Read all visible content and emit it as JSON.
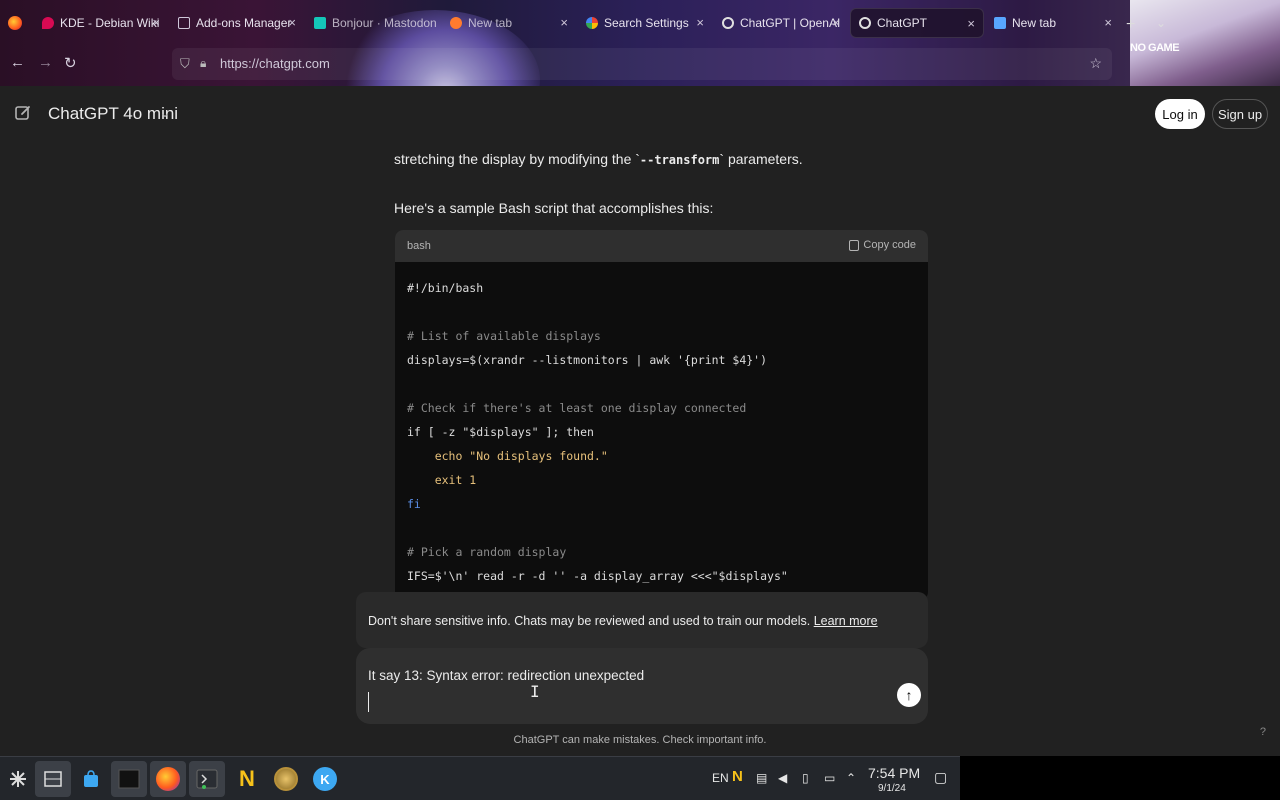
{
  "browser": {
    "tabs": [
      {
        "label": "KDE - Debian Wiki",
        "icon": "debian-icon",
        "color": "#d70a53"
      },
      {
        "label": "Add-ons Manager",
        "icon": "puzzle-icon",
        "color": "#cfc7d9"
      },
      {
        "label": "Bonjour · Mastodon",
        "icon": "mastodon-icon",
        "color": "#14c6b8"
      },
      {
        "label": "New tab",
        "icon": "firefox-icon",
        "color": "#ff7b2e"
      },
      {
        "label": "Search Settings",
        "icon": "google-icon",
        "color": "#4285f4"
      },
      {
        "label": "ChatGPT | OpenAI",
        "icon": "openai-icon",
        "color": "#e0e0e0"
      },
      {
        "label": "ChatGPT",
        "icon": "openai-icon",
        "color": "#e0e0e0"
      },
      {
        "label": "New tab",
        "icon": "firefox-icon",
        "color": "#58a6ff"
      }
    ],
    "close_glyph": "×",
    "url": "https://chatgpt.com",
    "wallpaper_label": "NO GAME"
  },
  "header": {
    "model_name": "ChatGPT 4o mini",
    "login_label": "Log in",
    "signup_label": "Sign up"
  },
  "content": {
    "para1_before": "stretching the display by modifying the `",
    "para1_code": "--transform",
    "para1_after": "` parameters.",
    "para2": "Here's a sample Bash script that accomplishes this:",
    "code": {
      "language": "bash",
      "copy_label": "Copy code",
      "lines": [
        {
          "t": "#!/bin/bash"
        },
        {
          "t": ""
        },
        {
          "t": "# List of available displays"
        },
        {
          "t": "displays=$(xrandr --listmonitors | awk '{print $4}')"
        },
        {
          "t": ""
        },
        {
          "t": "# Check if there's at least one display connected"
        },
        {
          "t": "if [ -z \"$displays\" ]; then"
        },
        {
          "t": "    echo \"No displays found.\""
        },
        {
          "t": "    exit 1"
        },
        {
          "t": "fi"
        },
        {
          "t": ""
        },
        {
          "t": "# Pick a random display"
        },
        {
          "t": "IFS=$'\\n' read -r -d '' -a display_array <<<\"$displays\""
        }
      ]
    },
    "notice_text": "Don't share sensitive info. Chats may be reviewed and used to train our models.",
    "notice_link": "Learn more",
    "composer_text": "It say 13: Syntax error: redirection unexpected",
    "disclaimer": "ChatGPT can make mistakes. Check important info.",
    "help": "?"
  },
  "taskbar": {
    "lang": "EN",
    "time": "7:54 PM",
    "date": "9/1/24"
  }
}
